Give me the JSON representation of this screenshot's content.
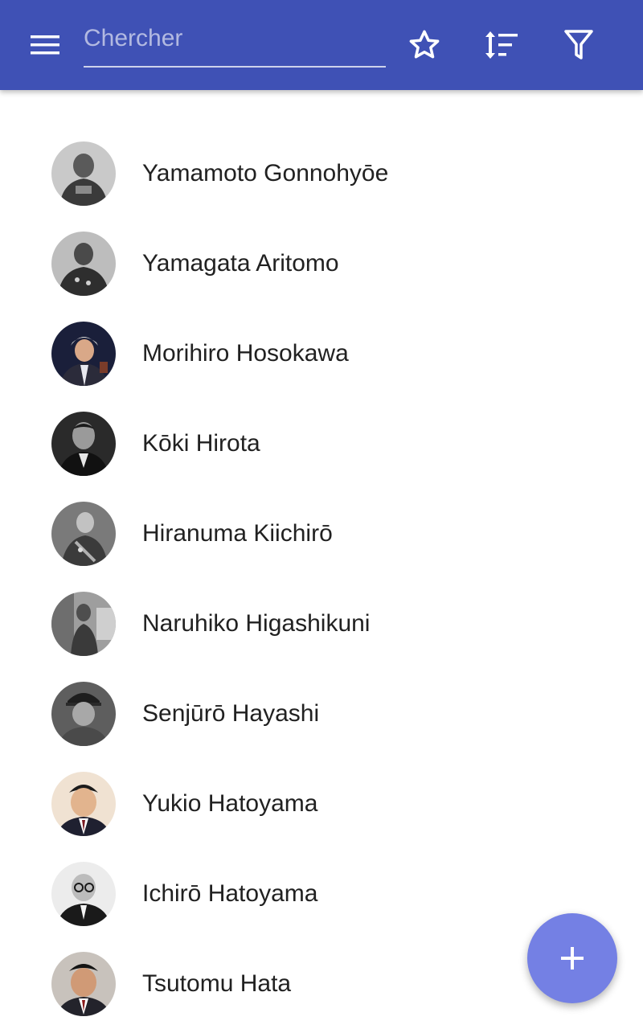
{
  "theme": {
    "appbar_color": "#3f51b5",
    "fab_color": "#7480e4",
    "text_color": "#212121"
  },
  "appbar": {
    "menu_icon": "hamburger-menu-icon",
    "search": {
      "placeholder": "Chercher",
      "value": ""
    },
    "actions": [
      {
        "name": "favorites",
        "icon": "star-outline-icon"
      },
      {
        "name": "sort",
        "icon": "sort-icon"
      },
      {
        "name": "filter",
        "icon": "filter-icon"
      }
    ]
  },
  "list": {
    "items": [
      {
        "label": "Yamamoto Gonnohyōe",
        "avatar": "grayscale-portrait"
      },
      {
        "label": "Yamagata Aritomo",
        "avatar": "grayscale-portrait"
      },
      {
        "label": "Morihiro Hosokawa",
        "avatar": "color-portrait"
      },
      {
        "label": "Kōki Hirota",
        "avatar": "grayscale-portrait"
      },
      {
        "label": "Hiranuma Kiichirō",
        "avatar": "grayscale-portrait"
      },
      {
        "label": "Naruhiko Higashikuni",
        "avatar": "grayscale-portrait"
      },
      {
        "label": "Senjūrō Hayashi",
        "avatar": "grayscale-portrait"
      },
      {
        "label": "Yukio Hatoyama",
        "avatar": "color-portrait"
      },
      {
        "label": "Ichirō Hatoyama",
        "avatar": "grayscale-portrait"
      },
      {
        "label": "Tsutomu Hata",
        "avatar": "color-portrait"
      }
    ]
  },
  "fab": {
    "icon": "plus-icon"
  }
}
